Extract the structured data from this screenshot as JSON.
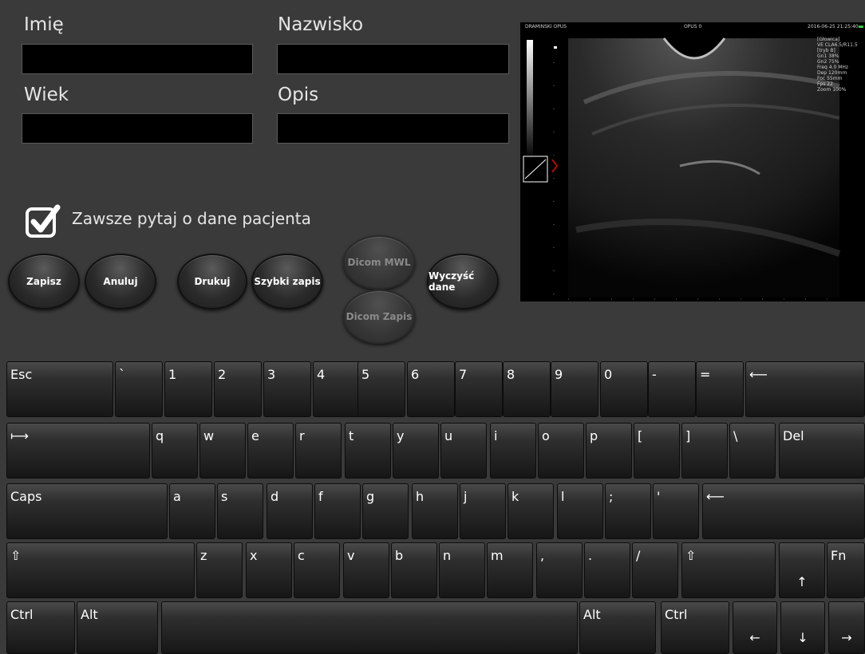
{
  "form": {
    "first_name_label": "Imię",
    "last_name_label": "Nazwisko",
    "age_label": "Wiek",
    "description_label": "Opis",
    "first_name_value": "",
    "last_name_value": "",
    "age_value": "",
    "description_value": "",
    "always_ask_label": "Zawsze pytaj o dane pacjenta",
    "always_ask_checked": true
  },
  "buttons": {
    "save": "Zapisz",
    "cancel": "Anuluj",
    "print": "Drukuj",
    "quick_save": "Szybki zapis",
    "dicom_mwl": "Dicom MWL",
    "dicom_save": "Dicom Zapis",
    "clear_data": "Wyczyść dane"
  },
  "ultrasound": {
    "top_left": "DRAMINSKI OPUS",
    "top_center": "OPUS 0",
    "top_right": "2016-06-25 21:25:40",
    "params": [
      "[Głowica]",
      "VE CLA6.5/R11.5",
      "",
      "[tryb B]",
      "Gn1 38%",
      "Gn2 75%",
      "Freq 4.0 MHz",
      "Dep 120mm",
      "Foc 55mm",
      "Fps 22",
      "Zoom 100%"
    ]
  },
  "keyboard": {
    "row1": [
      "Esc",
      "`",
      "1",
      "2",
      "3",
      "4",
      "5",
      "6",
      "7",
      "8",
      "9",
      "0",
      "-",
      "=",
      "⟵"
    ],
    "row2": [
      "⟼",
      "q",
      "w",
      "e",
      "r",
      "t",
      "y",
      "u",
      "i",
      "o",
      "p",
      "[",
      "]",
      "\\",
      "Del"
    ],
    "row3": [
      "Caps",
      "a",
      "s",
      "d",
      "f",
      "g",
      "h",
      "j",
      "k",
      "l",
      ";",
      "'",
      "⟵"
    ],
    "row4": [
      "⇧",
      "z",
      "x",
      "c",
      "v",
      "b",
      "n",
      "m",
      ",",
      ".",
      "/",
      "⇧",
      "↑",
      "Fn"
    ],
    "row5": [
      "Ctrl",
      "Alt",
      "",
      "Alt",
      "Ctrl",
      "←",
      "↓",
      "→"
    ]
  },
  "colors": {
    "background": "#3a3a3a",
    "field": "#000000",
    "checkbox": "#ffffff"
  }
}
